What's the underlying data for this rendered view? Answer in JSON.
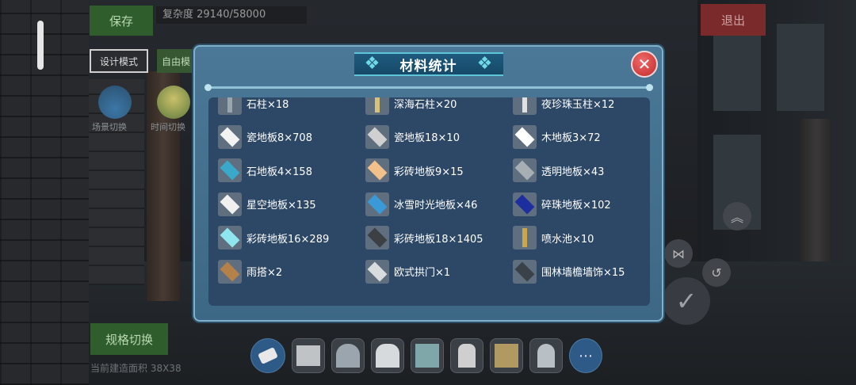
{
  "hud": {
    "save": "保存",
    "complexity": "复杂度 29140/58000",
    "exit": "退出",
    "design_mode": "设计模式",
    "free_mode": "自由模",
    "scene_switch": "场景切换",
    "time_switch": "时间切换",
    "spec_switch": "规格切换",
    "build_area": "当前建造面积 38X38"
  },
  "modal": {
    "title": "材料统计",
    "close_icon": "close-icon",
    "items": [
      {
        "name": "石柱×18",
        "icon": "stone-pillar-icon",
        "color": "#9aa6ad"
      },
      {
        "name": "深海石柱×20",
        "icon": "deepsea-pillar-icon",
        "color": "#d8c27a"
      },
      {
        "name": "夜珍珠玉柱×12",
        "icon": "pearl-jade-pillar-icon",
        "color": "#e0e0e0"
      },
      {
        "name": "瓷地板8×708",
        "icon": "porcelain-floor-icon",
        "color": "#f3f3f3"
      },
      {
        "name": "瓷地板18×10",
        "icon": "porcelain-floor-pattern-icon",
        "color": "#d0d0d0"
      },
      {
        "name": "木地板3×72",
        "icon": "wood-floor-icon",
        "color": "#ffffff"
      },
      {
        "name": "石地板4×158",
        "icon": "stone-floor-icon",
        "color": "#3aa9c9"
      },
      {
        "name": "彩砖地板9×15",
        "icon": "color-tile-floor-icon",
        "color": "#f2c08a"
      },
      {
        "name": "透明地板×43",
        "icon": "transparent-floor-icon",
        "color": "#a7aeb4"
      },
      {
        "name": "星空地板×135",
        "icon": "starry-floor-icon",
        "color": "#f0f0f0"
      },
      {
        "name": "冰雪时光地板×46",
        "icon": "ice-time-floor-icon",
        "color": "#3a9ad8"
      },
      {
        "name": "碎珠地板×102",
        "icon": "pearl-floor-icon",
        "color": "#1d2f9e"
      },
      {
        "name": "彩砖地板16×289",
        "icon": "color-tile-floor-16-icon",
        "color": "#8fe6ee"
      },
      {
        "name": "彩砖地板18×1405",
        "icon": "color-tile-floor-18-icon",
        "color": "#3c3f44"
      },
      {
        "name": "喷水池×10",
        "icon": "fountain-icon",
        "color": "#caa74a"
      },
      {
        "name": "雨搭×2",
        "icon": "awning-icon",
        "color": "#b5814a"
      },
      {
        "name": "欧式拱门×1",
        "icon": "arch-door-icon",
        "color": "#d9dcdf"
      },
      {
        "name": "围林墙檐墙饰×15",
        "icon": "wall-eave-icon",
        "color": "#3b4148"
      }
    ]
  },
  "toolbar": {
    "tools": [
      "eraser-icon",
      "wall-icon",
      "arch-window-icon",
      "gothic-window-icon",
      "cabinet-icon",
      "door-icon",
      "bookshelf-icon",
      "arched-door-icon"
    ],
    "more": "⋯"
  }
}
